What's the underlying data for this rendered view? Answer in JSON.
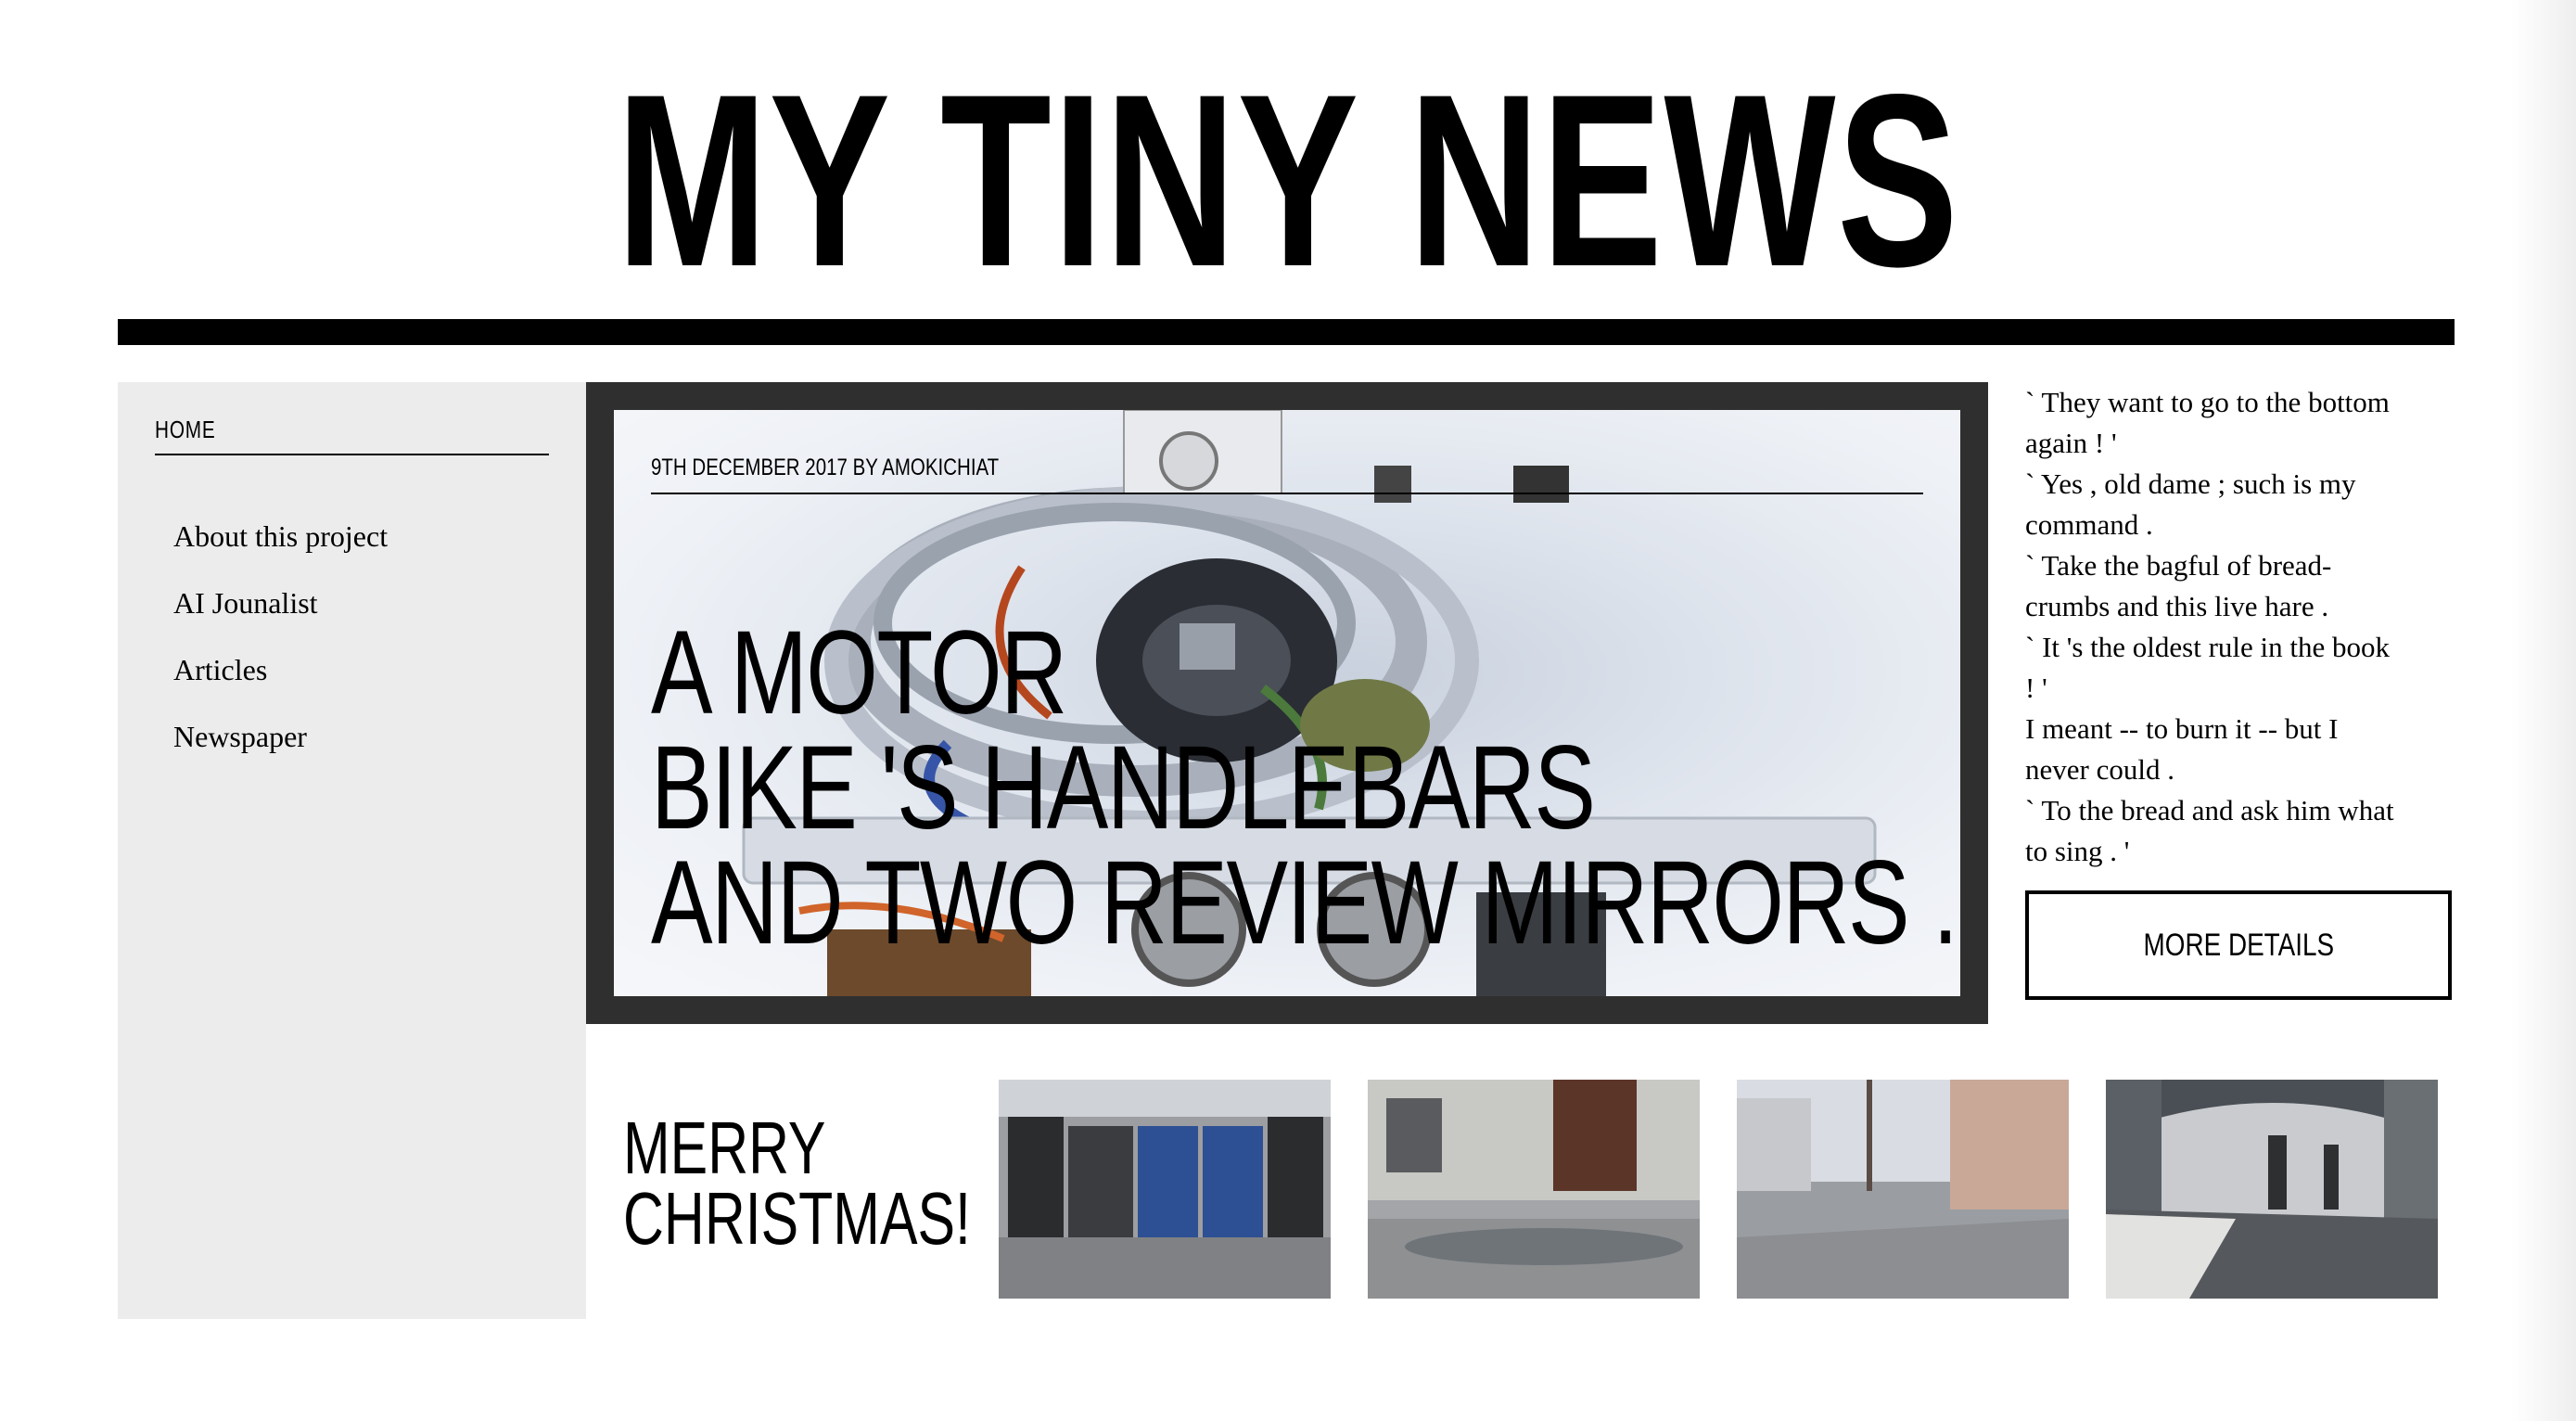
{
  "masthead": {
    "title": "MY TINY NEWS"
  },
  "sidebar": {
    "home_label": "HOME",
    "items": [
      {
        "label": "About this project"
      },
      {
        "label": "AI Jounalist"
      },
      {
        "label": "Articles"
      },
      {
        "label": "Newspaper"
      }
    ]
  },
  "feature": {
    "meta": "9TH DECEMBER 2017 BY AMOKICHIAT",
    "headline_lines": [
      "A MOTOR",
      "BIKE 'S HANDLEBARS",
      "AND TWO REVIEW MIRRORS ."
    ]
  },
  "quote": {
    "lines": [
      "` They want to go to the bottom",
      "again ! '",
      "` Yes , old dame ; such is my",
      "command .",
      "` Take the bagful of bread-",
      "crumbs and this live hare .",
      "` It 's the oldest rule in the book",
      "! '",
      "I meant -- to burn it -- but I",
      "never could .",
      "` To the bread and ask him what",
      "to sing . '"
    ]
  },
  "more_details": {
    "label": "MORE DETAILS"
  },
  "gallery": {
    "caption_lines": [
      "MERRY",
      "CHRISTMAS!"
    ]
  },
  "colors": {
    "frame": "#2f2f2f",
    "sidebar_bg": "#ececec",
    "ink": "#000000"
  }
}
